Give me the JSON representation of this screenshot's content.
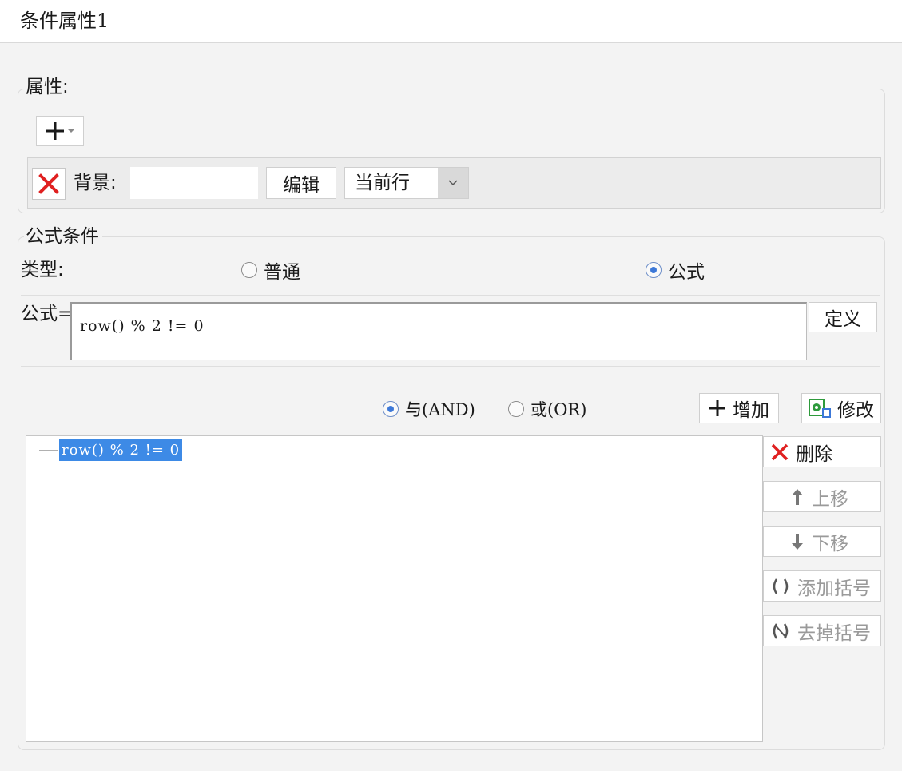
{
  "window": {
    "title": "条件属性1"
  },
  "attributes": {
    "legend": "属性:",
    "add_icon": "plus-dropdown-icon",
    "row": {
      "remove_icon": "red-x-icon",
      "label": "背景:",
      "value": "",
      "edit_label": "编辑",
      "scope_select": {
        "selected": "当前行"
      }
    }
  },
  "formula_condition": {
    "legend": "公式条件",
    "type_label": "类型:",
    "type_options": [
      {
        "label": "普通",
        "checked": false
      },
      {
        "label": "公式",
        "checked": true
      }
    ],
    "formula_label": "公式=",
    "formula_value": "row() % 2 != 0",
    "define_label": "定义",
    "logic_options": [
      {
        "label": "与(AND)",
        "checked": true
      },
      {
        "label": "或(OR)",
        "checked": false
      }
    ],
    "add_label": "增加",
    "modify_label": "修改",
    "tree_item": "row() % 2 != 0",
    "side_buttons": {
      "delete": "删除",
      "move_up": "上移",
      "move_down": "下移",
      "add_bracket": "添加括号",
      "remove_bracket": "去掉括号"
    }
  },
  "colors": {
    "accent": "#3c78d8",
    "selection": "#3d8ae6",
    "danger": "#e02020",
    "modify_icon": "#2e9a3c"
  }
}
